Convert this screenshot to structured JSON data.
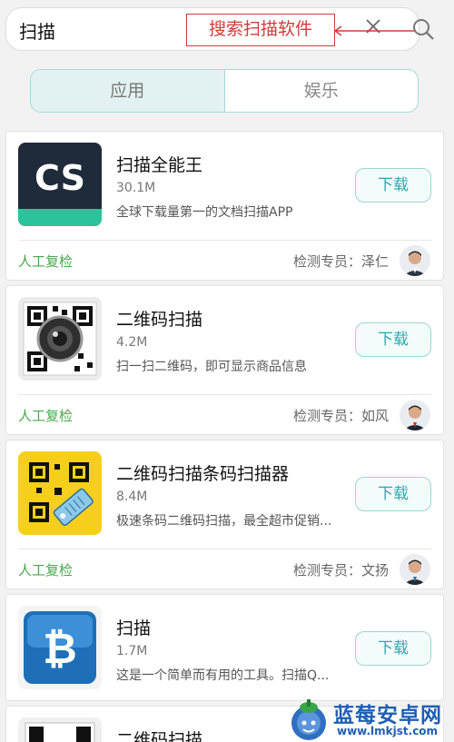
{
  "search": {
    "query": "扫描",
    "annotation": "搜索扫描软件"
  },
  "tabs": [
    {
      "label": "应用",
      "active": true
    },
    {
      "label": "娱乐",
      "active": false
    }
  ],
  "apps": [
    {
      "name": "扫描全能王",
      "size": "30.1M",
      "desc": "全球下载量第一的文档扫描APP",
      "download": "下载",
      "verified": "人工复检",
      "inspector": "检测专员：泽仁",
      "icon": "camscanner-icon"
    },
    {
      "name": "二维码扫描",
      "size": "4.2M",
      "desc": "扫一扫二维码，即可显示商品信息",
      "download": "下载",
      "verified": "人工复检",
      "inspector": "检测专员：如风",
      "icon": "qr-lens-icon"
    },
    {
      "name": "二维码扫描条码扫描器",
      "size": "8.4M",
      "desc": "极速条码二维码扫描，最全超市促销...",
      "download": "下载",
      "verified": "人工复检",
      "inspector": "检测专员：文扬",
      "icon": "qr-tag-icon"
    },
    {
      "name": "扫描",
      "size": "1.7M",
      "desc": "这是一个简单而有用的工具。扫描Q...",
      "download": "下载",
      "icon": "bitcoin-icon"
    },
    {
      "name": "二维码扫描"
    }
  ],
  "watermark": {
    "title": "蓝莓安卓网",
    "url": "www.lmkjst.com"
  },
  "colors": {
    "accent": "#2fa7ae",
    "verified_green": "#49a84d",
    "annotation_red": "#d23b3b"
  }
}
